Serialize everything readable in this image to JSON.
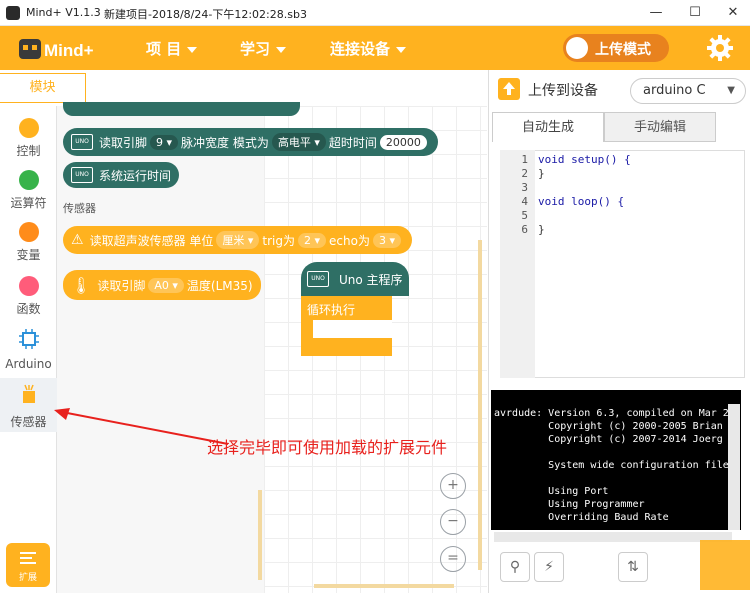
{
  "titlebar": {
    "app": "Mind+ V1.1.3",
    "document": "新建项目-2018/8/24-下午12:02:28.sb3",
    "minimize": "—",
    "maximize": "☐",
    "close": "✕"
  },
  "menubar": {
    "logo": "Mind+",
    "items": [
      {
        "label": "项 目"
      },
      {
        "label": "学习"
      },
      {
        "label": "连接设备"
      }
    ],
    "upload_mode": "上传模式"
  },
  "module_tab": "模块",
  "sidebar": {
    "categories": [
      {
        "label": "控制",
        "color": "#ffb21f"
      },
      {
        "label": "运算符",
        "color": "#37b34a"
      },
      {
        "label": "变量",
        "color": "#ff8c1a"
      },
      {
        "label": "函数",
        "color": "#ff5c7a"
      },
      {
        "label": "Arduino",
        "color": "#2a90d9"
      },
      {
        "label": "传感器",
        "color": "#ffb21f"
      }
    ],
    "extension": "扩展"
  },
  "flyout": {
    "block_pulse": {
      "text1": "读取引脚",
      "pin": "9",
      "text2": "脉冲宽度 模式为",
      "mode": "高电平",
      "text3": "超时时间",
      "timeout": "20000"
    },
    "block_runtime": "系统运行时间",
    "section_sensor": "传感器",
    "block_ultrasonic": {
      "text1": "读取超声波传感器 单位",
      "unit": "厘米",
      "text2": "trig为",
      "trig": "2",
      "text3": "echo为",
      "echo": "3"
    },
    "block_temp": {
      "text1": "读取引脚",
      "pin": "A0",
      "text2": "温度(LM35)"
    },
    "uno_label": "UNO"
  },
  "workspace": {
    "hat": "Uno 主程序",
    "loop": "循环执行"
  },
  "zoom": {
    "in": "+",
    "out": "−",
    "reset": "="
  },
  "right": {
    "upload_device": "上传到设备",
    "board": "arduino C",
    "tab_auto": "自动生成",
    "tab_manual": "手动编辑",
    "code_lines": [
      {
        "n": "1",
        "text": "void setup() {"
      },
      {
        "n": "2",
        "text": "}"
      },
      {
        "n": "3",
        "text": ""
      },
      {
        "n": "4",
        "text": "void loop() {"
      },
      {
        "n": "5",
        "text": ""
      },
      {
        "n": "6",
        "text": "}"
      }
    ],
    "console": [
      "avrdude: Version 6.3, compiled on Mar 2",
      "         Copyright (c) 2000-2005 Brian",
      "         Copyright (c) 2007-2014 Joerg",
      "",
      "         System wide configuration file",
      "",
      "         Using Port",
      "         Using Programmer",
      "         Overriding Baud Rate"
    ]
  },
  "annotation": "选择完毕即可使用加载的扩展元件",
  "colors": {
    "accent": "#ffb21f",
    "block_green": "#2f6f65",
    "annotation_red": "#e8211d"
  }
}
